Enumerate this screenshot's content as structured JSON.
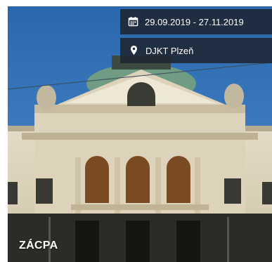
{
  "event": {
    "date_range": "29.09.2019 - 27.11.2019",
    "venue": "DJKT Plzeň",
    "title": "ZÁCPA"
  },
  "icons": {
    "date": "calendar-icon",
    "venue": "map-pin-icon"
  },
  "colors": {
    "sky": "#2b6fb6",
    "overlay": "#1e2734",
    "text": "#ffffff"
  }
}
